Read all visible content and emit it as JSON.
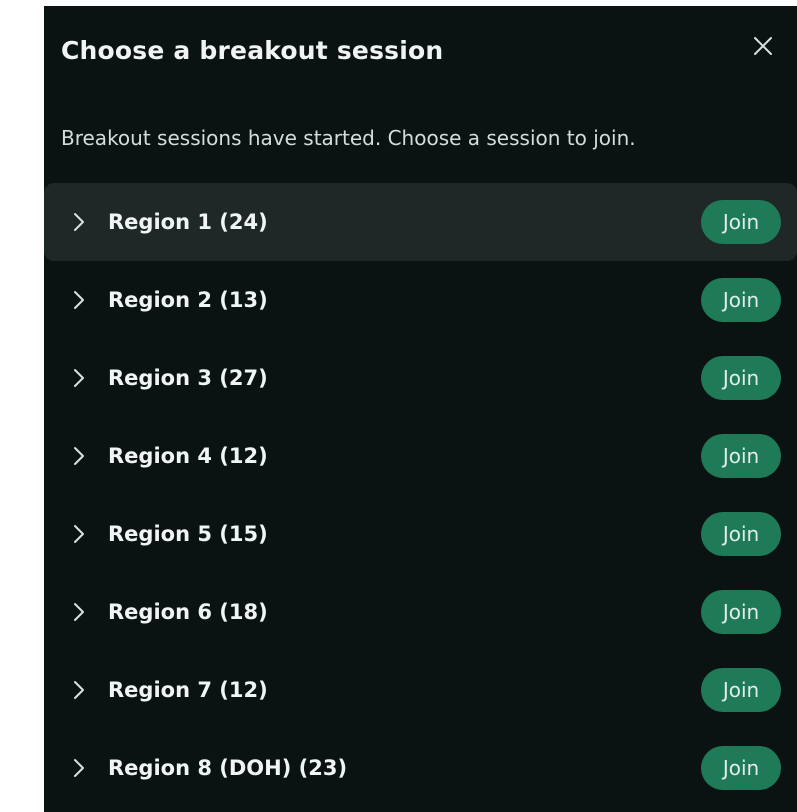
{
  "dialog": {
    "title": "Choose a breakout session",
    "subtitle": "Breakout sessions have started. Choose a session to join.",
    "close_icon": "close-icon"
  },
  "sessions": [
    {
      "label": "Region 1 (24)",
      "join_label": "Join",
      "selected": true
    },
    {
      "label": "Region 2 (13)",
      "join_label": "Join",
      "selected": false
    },
    {
      "label": "Region 3 (27)",
      "join_label": "Join",
      "selected": false
    },
    {
      "label": "Region 4 (12)",
      "join_label": "Join",
      "selected": false
    },
    {
      "label": "Region 5 (15)",
      "join_label": "Join",
      "selected": false
    },
    {
      "label": "Region 6 (18)",
      "join_label": "Join",
      "selected": false
    },
    {
      "label": "Region 7 (12)",
      "join_label": "Join",
      "selected": false
    },
    {
      "label": "Region 8 (DOH) (23)",
      "join_label": "Join",
      "selected": false
    }
  ],
  "colors": {
    "background": "#0b1212",
    "selected_row": "#1f2727",
    "join_button": "#1f7a58",
    "text": "#f1f4f4"
  }
}
